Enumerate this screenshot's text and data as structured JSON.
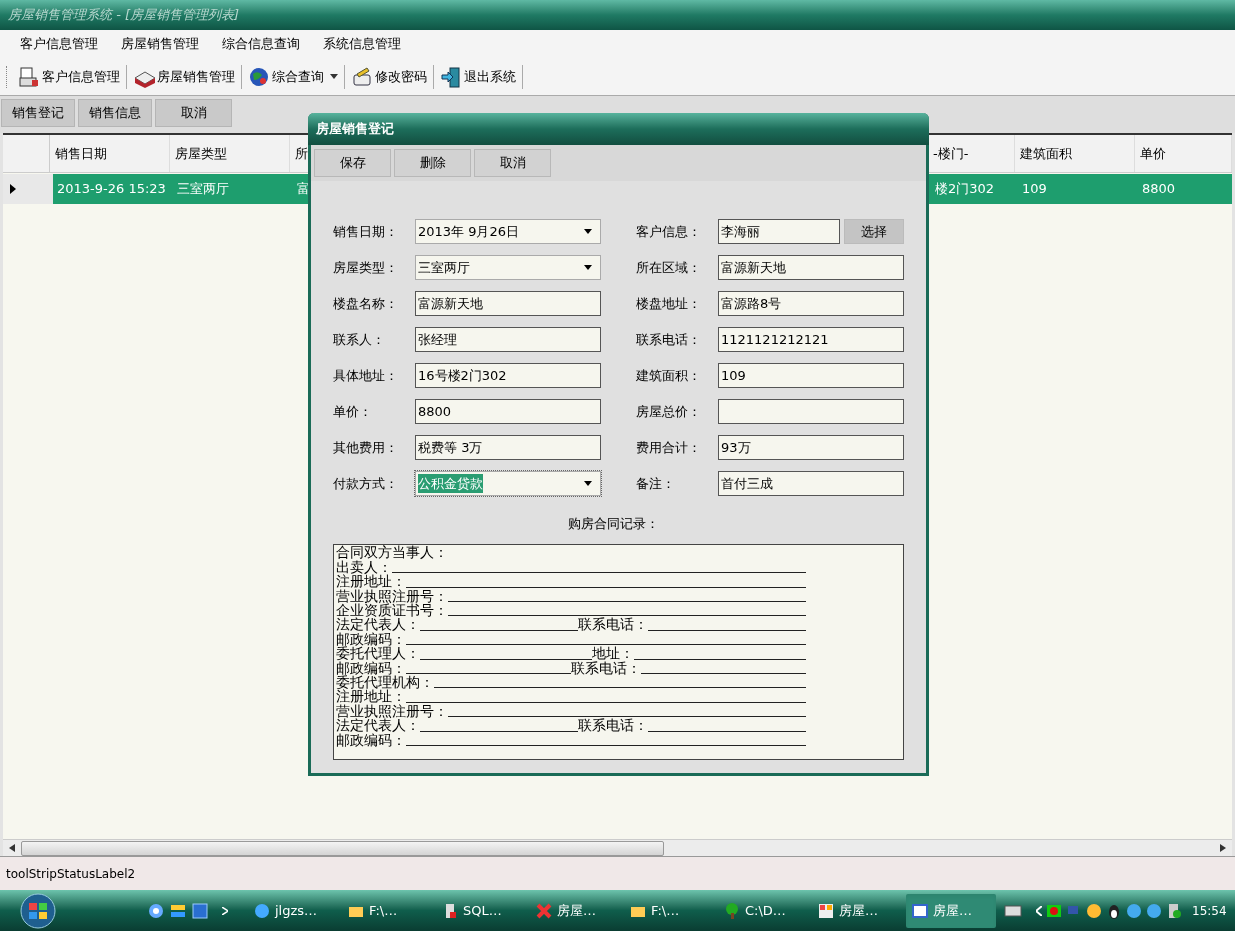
{
  "window": {
    "title": "房屋销售管理系统 - [房屋销售管理列表]"
  },
  "menu": [
    "客户信息管理",
    "房屋销售管理",
    "综合信息查询",
    "系统信息管理"
  ],
  "toolbar": [
    {
      "label": "客户信息管理",
      "kind": "button"
    },
    {
      "label": "房屋销售管理",
      "kind": "button"
    },
    {
      "label": "综合查询",
      "kind": "dropdown"
    },
    {
      "label": "修改密码",
      "kind": "button"
    },
    {
      "label": "退出系统",
      "kind": "button"
    }
  ],
  "actions": [
    "销售登记",
    "销售信息",
    "取消"
  ],
  "grid": {
    "columns": [
      "销售日期",
      "房屋类型",
      "所",
      "-楼门-",
      "建筑面积",
      "单价"
    ],
    "rows": [
      {
        "selected": true,
        "cells": [
          "2013-9-26 15:23",
          "三室两厅",
          "富",
          "楼2门302",
          "109",
          "8800"
        ]
      }
    ]
  },
  "dialog": {
    "title": "房屋销售登记",
    "buttons": [
      "保存",
      "删除",
      "取消"
    ],
    "fields": [
      {
        "label": "销售日期：",
        "value": "2013年 9月26日",
        "kind": "combo",
        "highlighted": false
      },
      {
        "label": "客户信息：",
        "value": "李海丽",
        "kind": "picker",
        "button": "选择",
        "highlighted": false
      },
      {
        "label": "房屋类型：",
        "value": "三室两厅",
        "kind": "combo",
        "highlighted": false
      },
      {
        "label": "所在区域：",
        "value": "富源新天地",
        "kind": "text",
        "highlighted": false
      },
      {
        "label": "楼盘名称：",
        "value": "富源新天地",
        "kind": "text",
        "highlighted": false
      },
      {
        "label": "楼盘地址：",
        "value": "富源路8号",
        "kind": "text",
        "highlighted": false
      },
      {
        "label": "联系人：",
        "value": "张经理",
        "kind": "text",
        "highlighted": false
      },
      {
        "label": "联系电话：",
        "value": "1121121212121",
        "kind": "text",
        "highlighted": false
      },
      {
        "label": "具体地址：",
        "value": "16号楼2门302",
        "kind": "text",
        "highlighted": false
      },
      {
        "label": "建筑面积：",
        "value": "109",
        "kind": "text",
        "highlighted": false
      },
      {
        "label": "单价：",
        "value": "8800",
        "kind": "text",
        "highlighted": false
      },
      {
        "label": "房屋总价：",
        "kind": "text",
        "highlighted": false
      },
      {
        "label": "其他费用：",
        "value": "税费等 3万",
        "kind": "text",
        "highlighted": false
      },
      {
        "label": "费用合计：",
        "value": "93万",
        "kind": "text",
        "highlighted": false
      },
      {
        "label": "付款方式：",
        "value": "公积金贷款",
        "kind": "combo",
        "highlighted": true
      },
      {
        "label": "备注：",
        "value": "首付三成",
        "kind": "text",
        "highlighted": false
      }
    ],
    "contract": {
      "label": "购房合同记录：",
      "lines": [
        {
          "kind": "heading",
          "parts": [
            "合同双方当事人："
          ]
        },
        {
          "kind": "blanks",
          "parts": [
            "出卖人："
          ]
        },
        {
          "kind": "blanks",
          "parts": [
            "注册地址："
          ]
        },
        {
          "kind": "blanks",
          "parts": [
            "营业执照注册号："
          ]
        },
        {
          "kind": "blanks",
          "parts": [
            "企业资质证书号："
          ]
        },
        {
          "kind": "blanks",
          "parts": [
            "法定代表人：",
            "联系电话："
          ]
        },
        {
          "kind": "blanks",
          "parts": [
            "邮政编码："
          ]
        },
        {
          "kind": "blanks",
          "parts": [
            "委托代理人：",
            "地址："
          ]
        },
        {
          "kind": "blanks",
          "parts": [
            "邮政编码：",
            "联系电话："
          ]
        },
        {
          "kind": "blanks",
          "parts": [
            "委托代理机构："
          ]
        },
        {
          "kind": "blanks",
          "parts": [
            "注册地址："
          ]
        },
        {
          "kind": "blanks",
          "parts": [
            "营业执照注册号："
          ]
        },
        {
          "kind": "blanks",
          "parts": [
            "法定代表人：",
            "联系电话："
          ]
        },
        {
          "kind": "blanks",
          "parts": [
            "邮政编码："
          ]
        }
      ]
    }
  },
  "status_bar": "toolStripStatusLabel2",
  "taskbar": {
    "items": [
      {
        "label": "jlgzs…",
        "selected": false
      },
      {
        "label": "F:\\…",
        "selected": false
      },
      {
        "label": "SQL…",
        "selected": false
      },
      {
        "label": "房屋…",
        "selected": false
      },
      {
        "label": "F:\\…",
        "selected": false
      },
      {
        "label": "C:\\D…",
        "selected": false
      },
      {
        "label": "房屋…",
        "selected": false
      },
      {
        "label": "房屋…",
        "selected": true
      }
    ],
    "clock": "15:54"
  }
}
